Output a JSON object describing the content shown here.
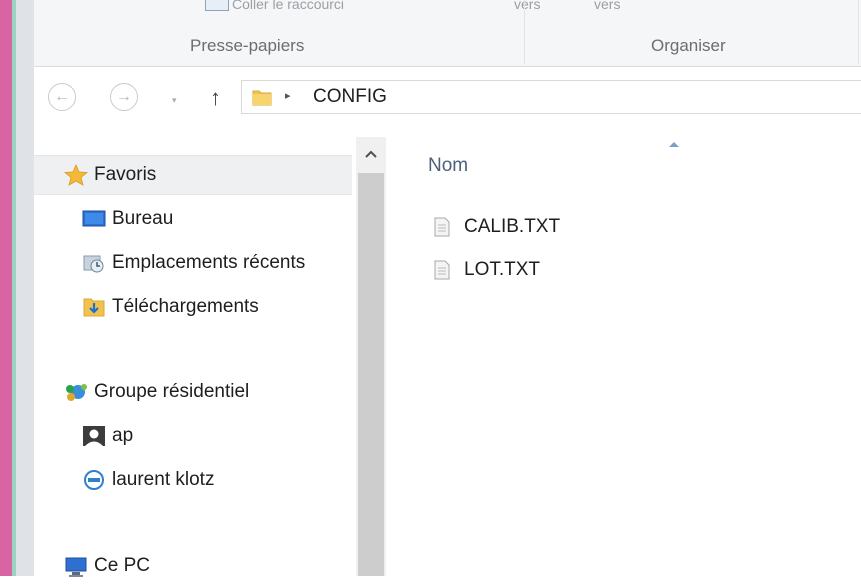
{
  "ribbon": {
    "top_clipped_left": "Coller le raccourci",
    "top_clipped_mid1": "vers",
    "top_clipped_mid2": "vers",
    "group_clipboard": "Presse-papiers",
    "group_organize": "Organiser"
  },
  "address": {
    "path": "CONFIG",
    "folder_icon": "folder-icon",
    "chevron": "▸"
  },
  "nav": {
    "back_icon": "back-arrow-icon",
    "forward_icon": "forward-arrow-icon",
    "up_icon": "up-arrow-icon",
    "up_glyph": "↑",
    "recent_glyph": "▾"
  },
  "navpane": {
    "favorites": {
      "label": "Favoris",
      "icon": "star-icon"
    },
    "favorites_items": [
      {
        "label": "Bureau",
        "icon": "desktop-icon"
      },
      {
        "label": "Emplacements récents",
        "icon": "recent-places-icon"
      },
      {
        "label": "Téléchargements",
        "icon": "downloads-icon"
      }
    ],
    "homegroup": {
      "label": "Groupe résidentiel",
      "icon": "homegroup-icon"
    },
    "homegroup_items": [
      {
        "label": "ap",
        "icon": "user-icon"
      },
      {
        "label": "laurent klotz",
        "icon": "dell-icon"
      }
    ],
    "this_pc": {
      "label": "Ce PC",
      "icon": "computer-icon"
    }
  },
  "scrollbar": {
    "up_glyph": "^"
  },
  "files": {
    "column_name": "Nom",
    "sort_glyph": "^",
    "items": [
      {
        "name": "CALIB.TXT",
        "icon": "text-file-icon"
      },
      {
        "name": "LOT.TXT",
        "icon": "text-file-icon"
      }
    ]
  },
  "colors": {
    "accent_pink": "#d964a3",
    "selection_bg": "#eef0f2",
    "header_text": "#4c607a"
  }
}
